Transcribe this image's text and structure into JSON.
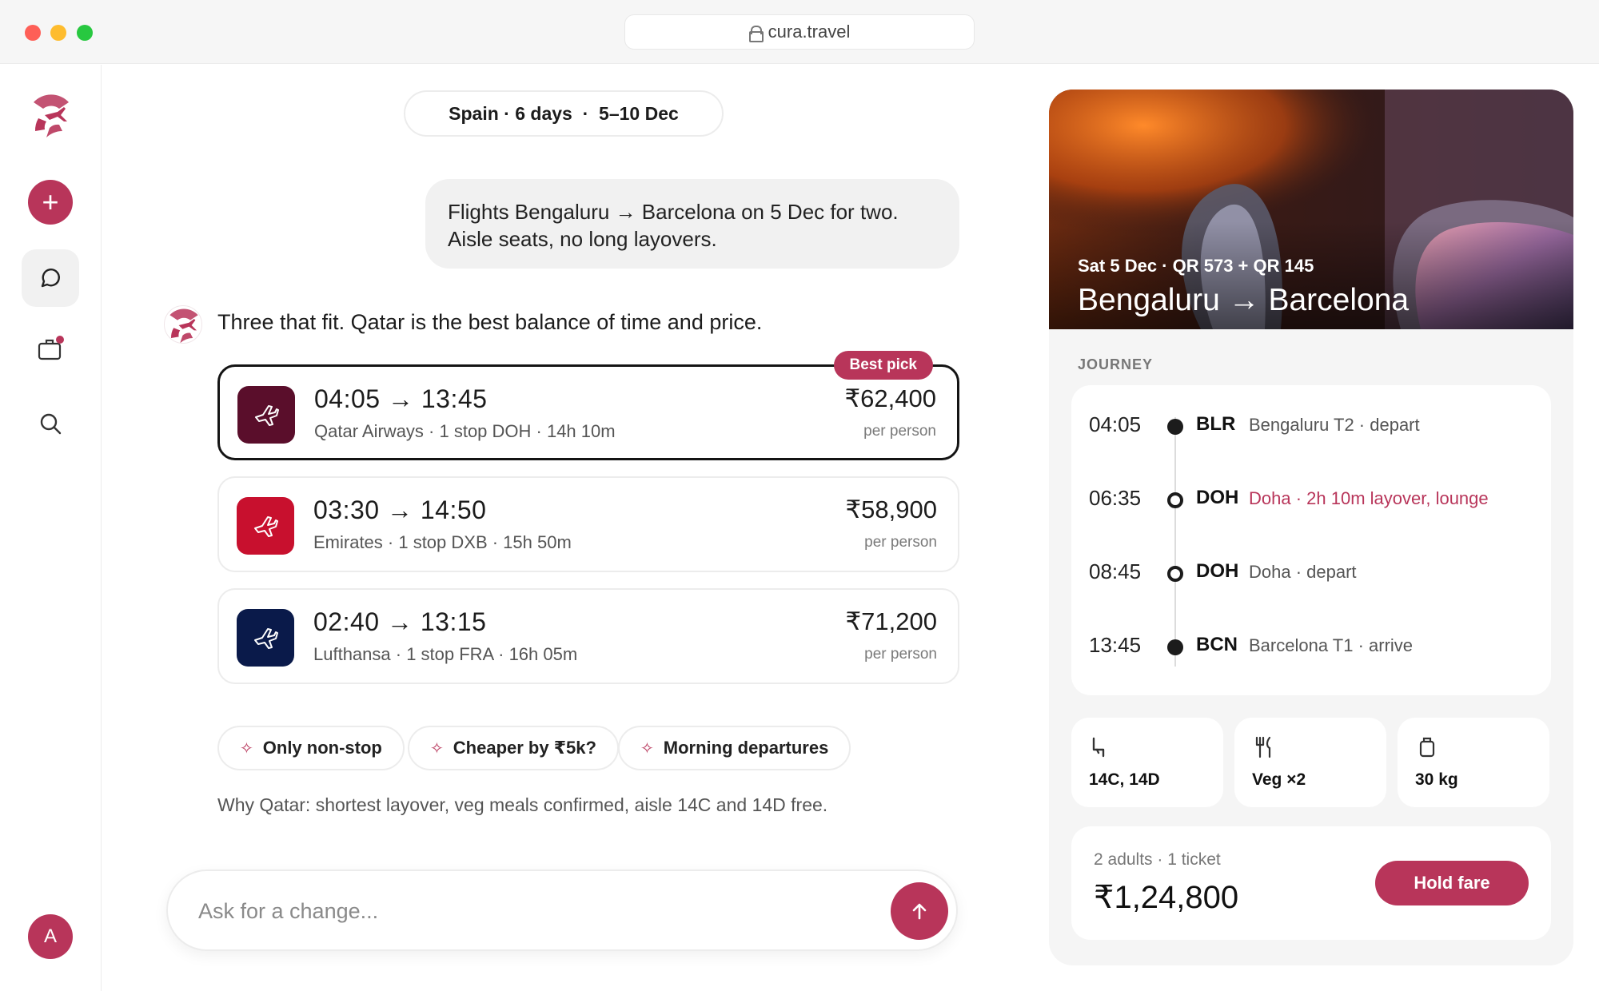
{
  "browser": {
    "url": "cura.travel",
    "traffic_colors": [
      "#fe5f57",
      "#febc2e",
      "#28c840"
    ]
  },
  "colors": {
    "accent": "#b8355a",
    "ink": "#1c1c1c",
    "muted": "#7a7a7a"
  },
  "rail": {
    "items": [
      {
        "icon": "logo-icon"
      },
      {
        "icon": "plus-icon"
      },
      {
        "icon": "chat-bubble-icon"
      },
      {
        "icon": "briefcase-icon"
      },
      {
        "icon": "search-icon"
      }
    ],
    "avatar_initial": "A"
  },
  "chat": {
    "trip_pill": "Spain · 6 days  ·  5–10 Dec",
    "user_message": "Flights Bengaluru → Barcelona on 5 Dec for two. Aisle seats, no long layovers.",
    "assistant_message": "Three that fit. Qatar is the best balance of time and price.",
    "best_tag": "Best pick",
    "flights": [
      {
        "times": "04:05 → 13:45",
        "meta": "Qatar Airways · 1 stop DOH · 14h 10m",
        "price": "₹62,400",
        "per": "per person",
        "logo_color": "#5a0e2b"
      },
      {
        "times": "03:30 → 14:50",
        "meta": "Emirates · 1 stop DXB · 15h 50m",
        "price": "₹58,900",
        "per": "per person",
        "logo_color": "#c8102e"
      },
      {
        "times": "02:40 → 13:15",
        "meta": "Lufthansa · 1 stop FRA · 16h 05m",
        "price": "₹71,200",
        "per": "per person",
        "logo_color": "#0a1a4a"
      }
    ],
    "chips": [
      "Only non-stop",
      "Cheaper by ₹5k?",
      "Morning departures"
    ],
    "why": "Why Qatar: shortest layover, veg meals confirmed, aisle 14C and 14D free.",
    "ask_placeholder": "Ask for a change..."
  },
  "panel": {
    "hero_subtitle": "Sat 5 Dec · QR 573 + QR 145",
    "hero_title": "Bengaluru → Barcelona",
    "journey_label": "JOURNEY",
    "stops": [
      {
        "time": "04:05",
        "code": "BLR",
        "desc": "Bengaluru T2 · depart",
        "filled": true,
        "highlight": false
      },
      {
        "time": "06:35",
        "code": "DOH",
        "desc": "Doha · 2h 10m layover, lounge",
        "filled": false,
        "highlight": true
      },
      {
        "time": "08:45",
        "code": "DOH",
        "desc": "Doha · depart",
        "filled": false,
        "highlight": false
      },
      {
        "time": "13:45",
        "code": "BCN",
        "desc": "Barcelona T1 · arrive",
        "filled": true,
        "highlight": false
      }
    ],
    "extras": [
      {
        "icon": "seat-icon",
        "value": "14C, 14D"
      },
      {
        "icon": "fork-knife-icon",
        "value": "Veg ×2"
      },
      {
        "icon": "luggage-icon",
        "value": "30 kg"
      }
    ],
    "total_label": "2 adults · 1 ticket",
    "total_value": "₹1,24,800",
    "hold_button": "Hold fare"
  }
}
